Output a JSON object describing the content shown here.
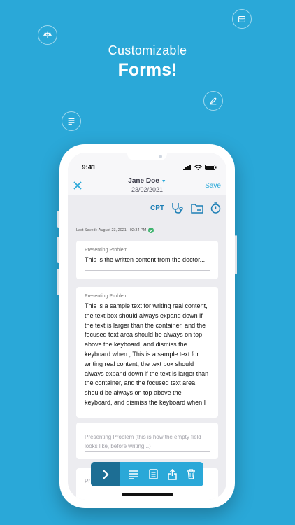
{
  "promo": {
    "line1": "Customizable",
    "line2": "Forms!"
  },
  "status": {
    "time": "9:41"
  },
  "header": {
    "patient_name": "Jane Doe",
    "date": "23/02/2021",
    "save_label": "Save"
  },
  "tools": {
    "cpt_label": "CPT"
  },
  "last_saved": "Last Saved : August 23, 2021 - 02:34 PM",
  "cards": [
    {
      "label": "Presenting Problem",
      "value": "This is the written content from the doctor..."
    },
    {
      "label": "Presenting Problem",
      "value": "This is a sample text for writing real content, the text box should always expand down if the text is larger than the container, and the focused text area should be always on top above the keyboard, and dismiss the keyboard when , This is a sample text for writing real content, the text box should always expand down if the text is larger than the container, and the focused text area should be always on top above the keyboard, and dismiss the keyboard when I"
    },
    {
      "placeholder": "Presenting Problem (this is how the empty field looks like, before writing...)"
    },
    {
      "partial_label": "Pr"
    }
  ],
  "colors": {
    "background": "#2aa8d8",
    "accent": "#2aa8d8",
    "toolbar_dark": "#1d6e94",
    "saved_ok": "#3db36d"
  }
}
